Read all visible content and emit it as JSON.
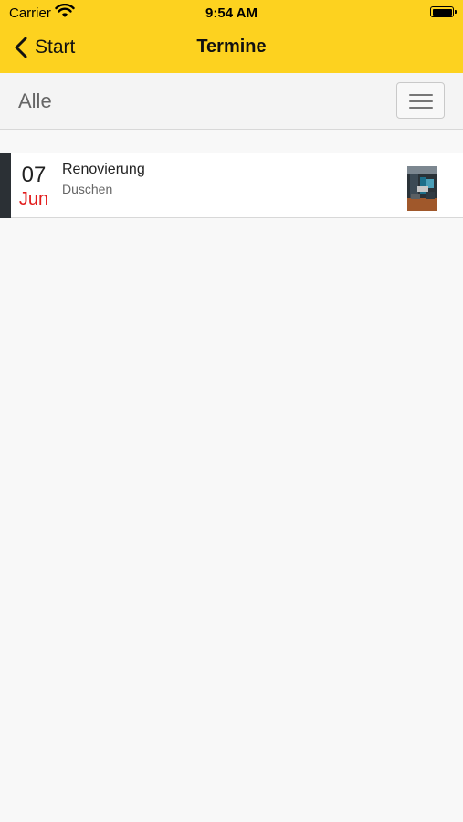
{
  "status_bar": {
    "carrier": "Carrier",
    "time": "9:54 AM"
  },
  "nav": {
    "back_label": "Start",
    "title": "Termine"
  },
  "filter": {
    "label": "Alle"
  },
  "appointments": [
    {
      "day": "07",
      "month": "Jun",
      "title": "Renovierung",
      "subtitle": "Duschen"
    }
  ],
  "colors": {
    "header_background": "#fdd21f",
    "month_text": "#e21b1b",
    "row_accent": "#2b3035"
  }
}
